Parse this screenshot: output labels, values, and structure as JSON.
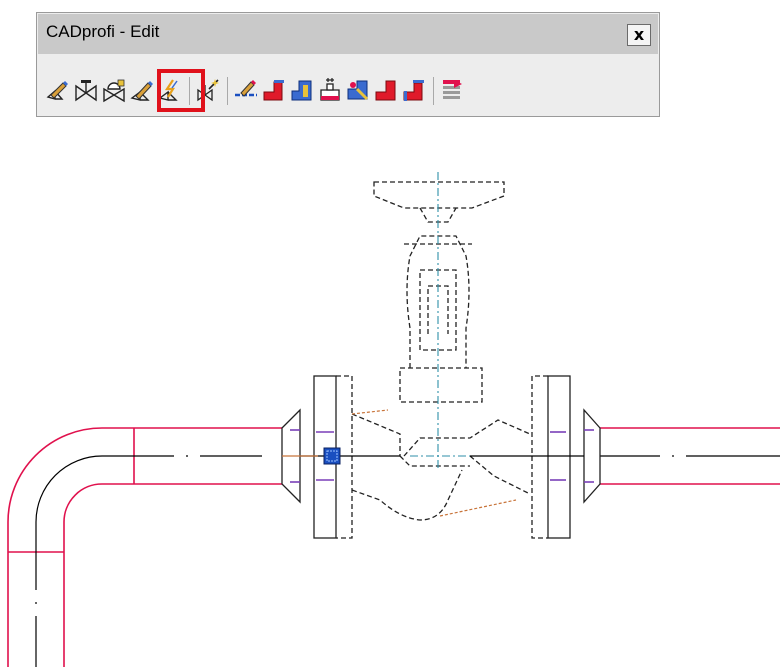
{
  "toolbar": {
    "title": "CADprofi - Edit",
    "close_label": "x",
    "buttons": [
      {
        "icon": "edit-symbol-icon",
        "highlighted": false
      },
      {
        "icon": "mirror-valve-icon",
        "highlighted": false
      },
      {
        "icon": "valve-actuator-icon",
        "highlighted": false
      },
      {
        "icon": "edit-object-icon",
        "highlighted": true
      },
      {
        "icon": "break-line-icon",
        "highlighted": false
      },
      {
        "icon": "auto-insert-icon",
        "highlighted": false
      },
      {
        "icon": "pipe-edit-icon",
        "highlighted": false
      },
      {
        "icon": "elbow-icon",
        "highlighted": false
      },
      {
        "icon": "elbow-reducer-icon",
        "highlighted": false
      },
      {
        "icon": "tee-fitting-icon",
        "highlighted": false
      },
      {
        "icon": "pipe-joint-icon",
        "highlighted": false
      },
      {
        "icon": "elbow-90-icon",
        "highlighted": false
      },
      {
        "icon": "elbow-flange-icon",
        "highlighted": false
      },
      {
        "icon": "list-table-icon",
        "highlighted": false
      }
    ]
  },
  "colors": {
    "pipe": "#e0114d",
    "highlight": "#e0111b",
    "axis": "#2f8fa8",
    "dimension": "#c8743a",
    "flange_marks": "#7a3fb8"
  }
}
